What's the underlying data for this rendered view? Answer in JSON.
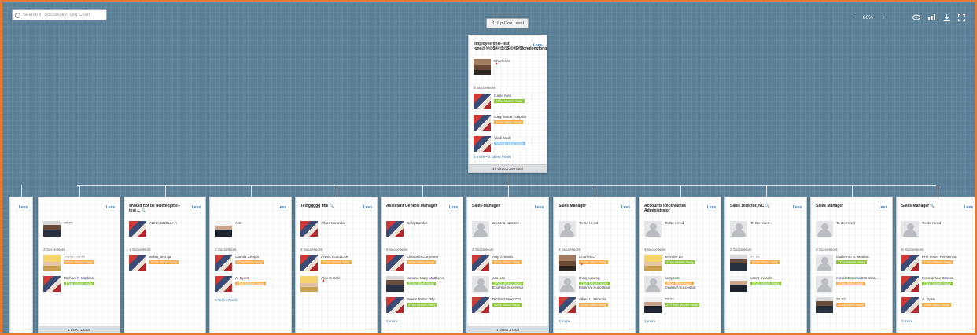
{
  "search": {
    "placeholder": "Search in Succession Org Chart"
  },
  "up_level": {
    "label": "Up One Level"
  },
  "toolbar": {
    "zoom_out": "−",
    "zoom_level": "80%",
    "zoom_in": "+"
  },
  "colors": {
    "canvas": "#5a7f96",
    "frame": "#e8782a",
    "link": "#2a6fb0",
    "tag_green": "#8dc63f",
    "tag_orange": "#f6ad4e",
    "tag_blue": "#8ac4ea"
  },
  "root": {
    "title": "employee title--test long@!#@$#@$@$@#$#$longlonglong...",
    "less": "Less",
    "incumbent": {
      "name": "Charles C",
      "avatar": "photo",
      "pin": true
    },
    "successors_count": "3 Successors",
    "successors": [
      {
        "name": "Gavin Alec",
        "tag": "2Two Moves Away",
        "tag_color": "green"
      },
      {
        "name": "Gary Tester Lolipran",
        "tag": "2One Move Away",
        "tag_color": "orange"
      },
      {
        "name": "Vladi Nadi",
        "tag": "2Ready Next Move",
        "tag_color": "blue"
      }
    ],
    "more": "6 more • 3 Talent Pools",
    "footer": "16 directs 209 total"
  },
  "children": [
    {
      "title": "",
      "less": "Less",
      "partial": true
    },
    {
      "title": "",
      "less": "Less",
      "incumbent": {
        "name": "?? ??",
        "avatar": "dark"
      },
      "successors_count": "2 Successors",
      "successors": [
        {
          "name": "????? ?????",
          "tag": "2Two Moves Away",
          "tag_color": "orange",
          "avatar": "woman"
        },
        {
          "name": "Michael F. Mathias",
          "tag": "2Two Moves Away",
          "tag_color": "green",
          "avatar": "red"
        }
      ],
      "more": "",
      "footer": "1 direct 1 total"
    },
    {
      "title": "should not be deleted|title--test ...",
      "less": "Less",
      "search_icon": true,
      "incumbent": {
        "name": "ANNA CUELLAR",
        "avatar": "red"
      },
      "successors_count": "1 Successors",
      "successors": [
        {
          "name": "asfsn_test qa",
          "tag": "2One Move Away",
          "tag_color": "orange",
          "avatar": "red"
        }
      ],
      "more": "",
      "footer": ""
    },
    {
      "title": "",
      "less": "Less",
      "incumbent": {
        "name": "A C",
        "avatar": "suit"
      },
      "successors_count": "2 Successors",
      "successors": [
        {
          "name": "Camila Chopin",
          "tag": "2One Move Away",
          "tag_color": "orange",
          "avatar": "red"
        },
        {
          "name": "A. Byers",
          "tag": "2Two Moves Away",
          "tag_color": "orange",
          "avatar": "red"
        }
      ],
      "more": "3 Talent Pools",
      "footer": ""
    },
    {
      "title": "Testggggg title",
      "less": "Less",
      "search_icon": true,
      "incumbent": {
        "name": "Alfred Miranda",
        "avatar": "red"
      },
      "successors_count": "2 Successors",
      "successors": [
        {
          "name": "ANNA CUELLAR",
          "tag": "2Two Moves Away",
          "tag_color": "orange",
          "avatar": "red"
        },
        {
          "name": "Alex G Cole",
          "tag": "",
          "tag_color": "",
          "avatar": "woman",
          "pin": true
        }
      ],
      "more": "",
      "footer": ""
    },
    {
      "title": "Assistant General Manager",
      "less": "Less",
      "incumbent": {
        "name": "Sahij Bandar",
        "avatar": "red"
      },
      "successors_count": "5 Successors",
      "successors": [
        {
          "name": "Elizabeth Carpenter",
          "tag": "2One Move Away",
          "tag_color": "orange",
          "avatar": "red"
        },
        {
          "name": "ramana Mary Matthews",
          "tag": "2One Move Away",
          "tag_color": "green",
          "avatar": "dark"
        },
        {
          "name": "Beer's Tester \"Fly",
          "tag": "2Two Moves Away",
          "tag_color": "green",
          "avatar": "red"
        }
      ],
      "more": "2 more",
      "footer": ""
    },
    {
      "title": "Sales-Manager",
      "less": "Less",
      "incumbent": {
        "name": "cqrosn1 cqrosn1",
        "avatar": "grey"
      },
      "successors_count": "3 Successors",
      "successors": [
        {
          "name": "Arty J. Smith",
          "tag": "2One Move Away",
          "tag_color": "orange",
          "avatar": "red"
        },
        {
          "name": "asa asa",
          "tag": "2Two Moves Away",
          "tag_color": "green",
          "avatar": "grey",
          "sub": "External Successor"
        },
        {
          "name": "Richard Maxx???",
          "tag": "2One Move Away",
          "tag_color": "green",
          "avatar": "red"
        }
      ],
      "more": "",
      "footer": "1 direct 1 total"
    },
    {
      "title": "Sales Manager",
      "less": "Less",
      "incumbent": {
        "name": "To Be Hired",
        "avatar": "grey"
      },
      "successors_count": "6 Successors",
      "successors": [
        {
          "name": "Charles C",
          "tag": "2One Move Away",
          "tag_color": "orange",
          "avatar": "photo",
          "pin": true
        },
        {
          "name": "tinaq ouoeng",
          "tag": "2Two Moves Away",
          "tag_color": "green",
          "avatar": "grey",
          "sub": "External Successor"
        },
        {
          "name": "Alfred L. Miranda",
          "tag": "2One Move Away",
          "tag_color": "orange",
          "avatar": "red"
        }
      ],
      "more": "3 more",
      "footer": ""
    },
    {
      "title": "Accounts Receivables Administrator",
      "less": "Less",
      "incumbent": {
        "name": "To Be Hired",
        "avatar": "grey"
      },
      "successors_count": "4 Successors",
      "successors": [
        {
          "name": "Jennifer Lo",
          "tag": "2Two Moves Away",
          "tag_color": "green",
          "avatar": "woman"
        },
        {
          "name": "betty test",
          "tag": "2One Move Away",
          "tag_color": "orange",
          "avatar": "grey",
          "sub": "External Successor"
        },
        {
          "name": "?? ??",
          "tag": "2?? Two Moves Away",
          "tag_color": "green",
          "avatar": "suit"
        }
      ],
      "more": "1 more",
      "footer": ""
    },
    {
      "title": "Sales Director, NC",
      "less": "Less",
      "search_icon": true,
      "incumbent": {
        "name": "To Be Hired",
        "avatar": "grey"
      },
      "successors_count": "2 Successors",
      "successors": [
        {
          "name": "?? ??",
          "tag": "2One Move Away",
          "tag_color": "orange",
          "avatar": "dark"
        },
        {
          "name": "user1 miracle",
          "tag": "2Two Moves Away",
          "tag_color": "green",
          "avatar": "suit"
        }
      ],
      "more": "",
      "footer": ""
    },
    {
      "title": "Sales Manager",
      "less": "Less",
      "incumbent": {
        "name": "To Be Hired",
        "avatar": "grey"
      },
      "successors_count": "3 Successors",
      "successors": [
        {
          "name": "Guillermo S. Medina",
          "tag": "2Two Moves Away",
          "tag_color": "green",
          "avatar": "grey"
        },
        {
          "name": "miracleExternal999 mira...",
          "tag": "2One Move Away",
          "tag_color": "orange",
          "avatar": "grey"
        },
        {
          "name": "?? ??",
          "tag": "2One Move Away",
          "tag_color": "orange",
          "avatar": "dark"
        }
      ],
      "more": "",
      "footer": ""
    },
    {
      "title": "Sales Manager",
      "less": "Less",
      "search_icon": true,
      "incumbent": {
        "name": "To Be Hired",
        "avatar": "grey"
      },
      "successors_count": "6 Successors",
      "successors": [
        {
          "name": "Phil Tester Fenstlinca",
          "tag": "2TwO Moves Away",
          "tag_color": "orange",
          "avatar": "red"
        },
        {
          "name": "Konstantine Drasos",
          "tag": "2Two Moves Away",
          "tag_color": "green",
          "avatar": "red"
        },
        {
          "name": "A. Byers",
          "tag": "2One Move Away",
          "tag_color": "orange",
          "avatar": "red"
        }
      ],
      "more": "3 more",
      "footer": ""
    }
  ]
}
